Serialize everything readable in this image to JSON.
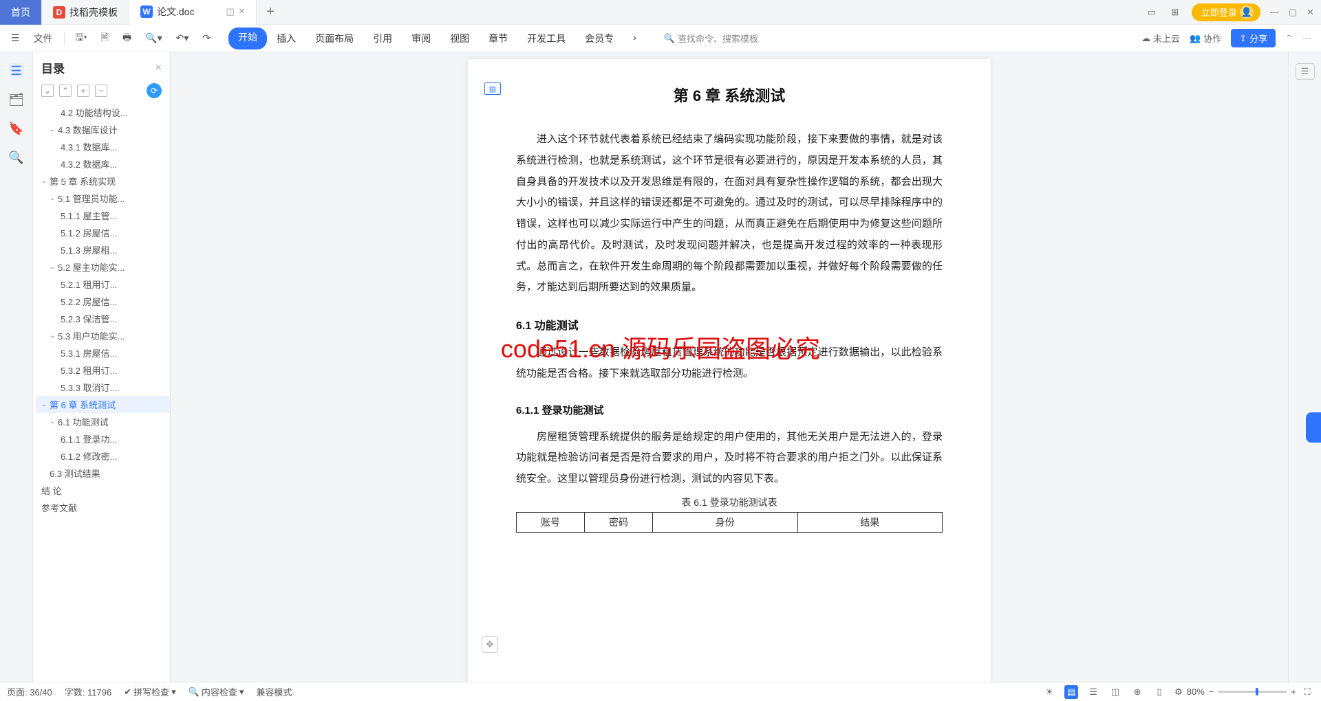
{
  "tabs": {
    "home": "首页",
    "template": "找稻壳模板",
    "doc": "论文.doc"
  },
  "tab_add": "+",
  "title_right": {
    "login": "立即登录"
  },
  "ribbon": {
    "file": "文件",
    "menu": [
      "开始",
      "插入",
      "页面布局",
      "引用",
      "审阅",
      "视图",
      "章节",
      "开发工具",
      "会员专"
    ],
    "search_placeholder": "查找命令、搜索模板",
    "cloud": "未上云",
    "collab": "协作",
    "share": "分享"
  },
  "outline": {
    "title": "目录",
    "tools": [
      "⌄",
      "⌃",
      "+",
      "−"
    ],
    "items": [
      {
        "l": 2,
        "t": "4.2 功能结构设..."
      },
      {
        "l": 1,
        "t": "4.3 数据库设计",
        "h": true
      },
      {
        "l": 2,
        "t": "4.3.1 数据库..."
      },
      {
        "l": 2,
        "t": "4.3.2 数据库..."
      },
      {
        "l": 0,
        "t": "第 5 章 系统实现",
        "h": true
      },
      {
        "l": 1,
        "t": "5.1 管理员功能...",
        "h": true
      },
      {
        "l": 2,
        "t": "5.1.1 屋主管..."
      },
      {
        "l": 2,
        "t": "5.1.2 房屋信..."
      },
      {
        "l": 2,
        "t": "5.1.3 房屋租..."
      },
      {
        "l": 1,
        "t": "5.2 屋主功能实...",
        "h": true
      },
      {
        "l": 2,
        "t": "5.2.1 租用订..."
      },
      {
        "l": 2,
        "t": "5.2.2 房屋信..."
      },
      {
        "l": 2,
        "t": "5.2.3 保洁管..."
      },
      {
        "l": 1,
        "t": "5.3 用户功能实...",
        "h": true
      },
      {
        "l": 2,
        "t": "5.3.1 房屋信..."
      },
      {
        "l": 2,
        "t": "5.3.2 租用订..."
      },
      {
        "l": 2,
        "t": "5.3.3 取消订..."
      },
      {
        "l": 0,
        "t": "第 6 章 系统测试",
        "h": true,
        "sel": true
      },
      {
        "l": 1,
        "t": "6.1 功能测试",
        "h": true
      },
      {
        "l": 2,
        "t": "6.1.1 登录功..."
      },
      {
        "l": 2,
        "t": "6.1.2 修改密..."
      },
      {
        "l": 1,
        "t": "6.3 测试结果"
      },
      {
        "l": 0,
        "t": "结  论"
      },
      {
        "l": 0,
        "t": "参考文献"
      }
    ]
  },
  "doc": {
    "title": "第 6 章  系统测试",
    "para1": "进入这个环节就代表着系统已经结束了编码实现功能阶段，接下来要做的事情，就是对该系统进行检测，也就是系统测试，这个环节是很有必要进行的，原因是开发本系统的人员，其自身具备的开发技术以及开发思维是有限的，在面对具有复杂性操作逻辑的系统，都会出现大大小小的错误，并且这样的错误还都是不可避免的。通过及时的测试，可以尽早排除程序中的错误，这样也可以减少实际运行中产生的问题，从而真正避免在后期使用中为修复这些问题所付出的高昂代价。及时测试，及时发现问题并解决，也是提高开发过程的效率的一种表现形式。总而言之，在软件开发生命周期的每个阶段都需要加以重视，并做好每个阶段需要做的任务，才能达到后期所要达到的效果质量。",
    "h2_61": "6.1  功能测试",
    "para2": "通过设计一些数据检验房屋租赁管理系统的功能是否根据预定进行数据输出，以此检验系统功能是否合格。接下来就选取部分功能进行检测。",
    "h3_611": "6.1.1  登录功能测试",
    "para3": "房屋租赁管理系统提供的服务是给规定的用户使用的，其他无关用户是无法进入的，登录功能就是检验访问者是否是符合要求的用户，及时将不符合要求的用户拒之门外。以此保证系统安全。这里以管理员身份进行检测，测试的内容见下表。",
    "tbl_caption": "表 6.1 登录功能测试表",
    "tbl_headers": [
      "账号",
      "密码",
      "身份",
      "结果"
    ]
  },
  "status": {
    "page": "页面: 36/40",
    "words": "字数: 11796",
    "spell": "拼写检查",
    "content": "内容检查",
    "compat": "兼容模式",
    "zoom": "80%"
  },
  "watermark": "code51.cn",
  "watermark_main": "code51.cn 源码乐园盗图必究"
}
